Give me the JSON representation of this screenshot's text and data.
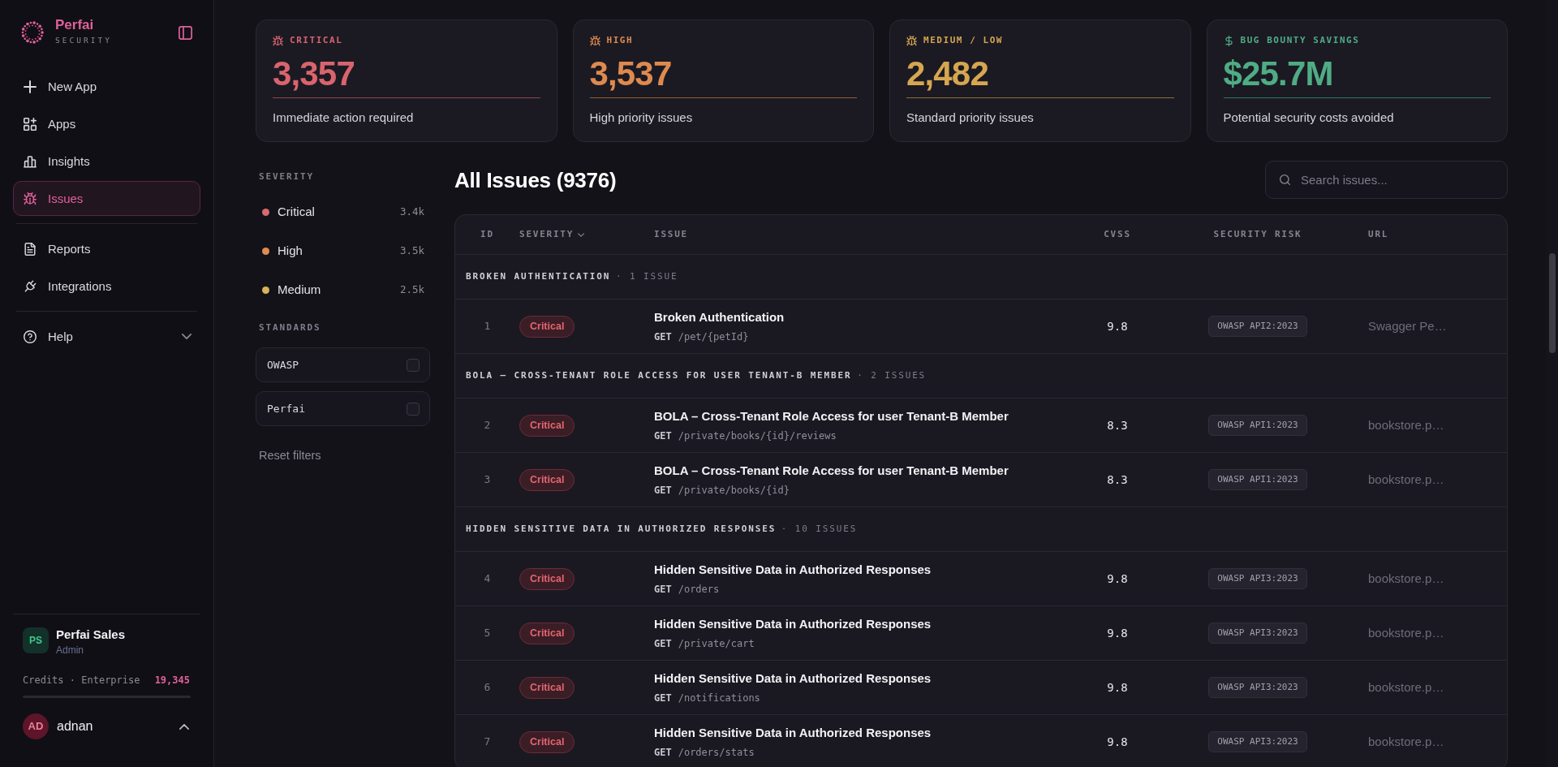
{
  "sidebar": {
    "brand": {
      "name": "Perfai",
      "tagline": "SECURITY"
    },
    "nav_groups": [
      {
        "items": [
          {
            "label": "New App",
            "selected": false
          },
          {
            "label": "Apps",
            "selected": false
          },
          {
            "label": "Insights",
            "selected": false
          },
          {
            "label": "Issues",
            "selected": true
          }
        ]
      },
      {
        "items": [
          {
            "label": "Reports",
            "selected": false
          },
          {
            "label": "Integrations",
            "selected": false
          }
        ]
      },
      {
        "items": [
          {
            "label": "Help",
            "selected": false,
            "expanded": false
          }
        ]
      }
    ],
    "account": {
      "initials": "PS",
      "name": "Perfai Sales",
      "role": "Admin",
      "plan": "Credits · Enterprise",
      "credits": "19,345"
    },
    "user": {
      "initials": "AD",
      "name": "adnan",
      "expanded": false
    }
  },
  "stats": [
    {
      "kind": "severity",
      "label": "CRITICAL",
      "value": "3,357",
      "caption": "Immediate action required",
      "color": "#d9646e"
    },
    {
      "kind": "severity",
      "label": "HIGH",
      "value": "3,537",
      "caption": "High priority issues",
      "color": "#de8a4f"
    },
    {
      "kind": "severity",
      "label": "MEDIUM / LOW",
      "value": "2,482",
      "caption": "Standard priority issues",
      "color": "#d6a650"
    },
    {
      "kind": "savings",
      "label": "BUG BOUNTY SAVINGS",
      "value": "$25.7M",
      "caption": "Potential security costs avoided",
      "color": "#4fac84"
    }
  ],
  "filters": {
    "severity": {
      "title": "SEVERITY",
      "options": [
        {
          "label": "Critical",
          "count": "3.4k",
          "color": "#d96a70",
          "selected": false
        },
        {
          "label": "High",
          "count": "3.5k",
          "color": "#e08b4f",
          "selected": false
        },
        {
          "label": "Medium",
          "count": "2.5k",
          "color": "#d9b35a",
          "selected": false
        }
      ]
    },
    "standards": {
      "title": "STANDARDS",
      "options": [
        {
          "label": "OWASP",
          "checked": false
        },
        {
          "label": "Perfai",
          "checked": false
        }
      ]
    },
    "reset": "Reset filters"
  },
  "issues": {
    "title": "All Issues (9376)",
    "search": {
      "placeholder": "Search issues..."
    },
    "columns": [
      {
        "label": "ID",
        "sorted": false
      },
      {
        "label": "SEVERITY",
        "sorted": true
      },
      {
        "label": "ISSUE",
        "sorted": false
      },
      {
        "label": "CVSS",
        "sorted": false
      },
      {
        "label": "SECURITY RISK",
        "sorted": false
      },
      {
        "label": "URL",
        "sorted": false
      }
    ],
    "groups": [
      {
        "title": "BROKEN AUTHENTICATION",
        "count": "· 1 ISSUE",
        "rows": [
          {
            "id": "1",
            "kind": "critical",
            "severity": "Critical",
            "title": "Broken Authentication",
            "method": "GET",
            "path": "/pet/{petId}",
            "cvss": "9.8",
            "risk": "OWASP API2:2023",
            "url": "Swagger Pe…"
          }
        ]
      },
      {
        "title": "BOLA – CROSS-TENANT ROLE ACCESS FOR USER TENANT-B MEMBER",
        "count": "· 2 ISSUES",
        "rows": [
          {
            "id": "2",
            "kind": "critical",
            "severity": "Critical",
            "title": "BOLA – Cross-Tenant Role Access for user Tenant-B Member",
            "method": "GET",
            "path": "/private/books/{id}/reviews",
            "cvss": "8.3",
            "risk": "OWASP API1:2023",
            "url": "bookstore.p…"
          },
          {
            "id": "3",
            "kind": "critical",
            "severity": "Critical",
            "title": "BOLA – Cross-Tenant Role Access for user Tenant-B Member",
            "method": "GET",
            "path": "/private/books/{id}",
            "cvss": "8.3",
            "risk": "OWASP API1:2023",
            "url": "bookstore.p…"
          }
        ]
      },
      {
        "title": "HIDDEN SENSITIVE DATA IN AUTHORIZED RESPONSES",
        "count": "· 10 ISSUES",
        "rows": [
          {
            "id": "4",
            "kind": "critical",
            "severity": "Critical",
            "title": "Hidden Sensitive Data in Authorized Responses",
            "method": "GET",
            "path": "/orders",
            "cvss": "9.8",
            "risk": "OWASP API3:2023",
            "url": "bookstore.p…"
          },
          {
            "id": "5",
            "kind": "critical",
            "severity": "Critical",
            "title": "Hidden Sensitive Data in Authorized Responses",
            "method": "GET",
            "path": "/private/cart",
            "cvss": "9.8",
            "risk": "OWASP API3:2023",
            "url": "bookstore.p…"
          },
          {
            "id": "6",
            "kind": "critical",
            "severity": "Critical",
            "title": "Hidden Sensitive Data in Authorized Responses",
            "method": "GET",
            "path": "/notifications",
            "cvss": "9.8",
            "risk": "OWASP API3:2023",
            "url": "bookstore.p…"
          },
          {
            "id": "7",
            "kind": "critical",
            "severity": "Critical",
            "title": "Hidden Sensitive Data in Authorized Responses",
            "method": "GET",
            "path": "/orders/stats",
            "cvss": "9.8",
            "risk": "OWASP API3:2023",
            "url": "bookstore.p…"
          }
        ]
      }
    ]
  }
}
